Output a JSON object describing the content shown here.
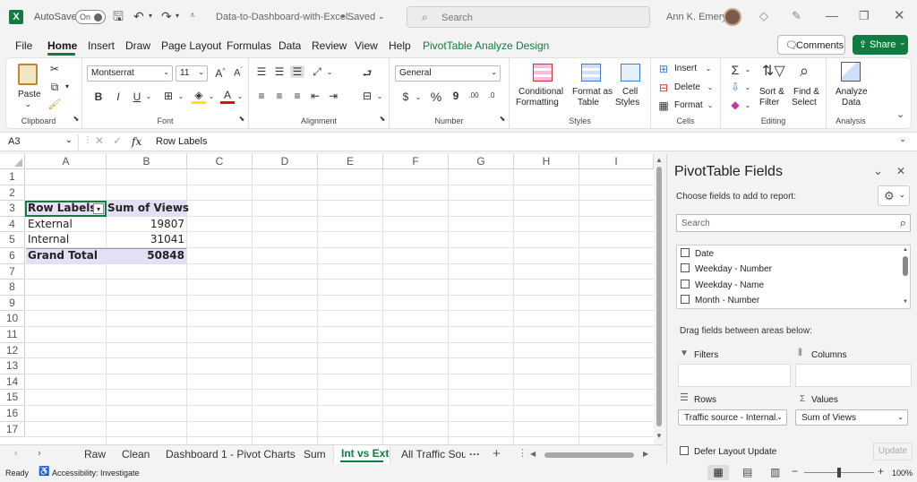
{
  "titlebar": {
    "autosave_label": "AutoSave",
    "autosave_state": "On",
    "filename": "Data-to-Dashboard-with-Excel...",
    "saved_status": "• Saved",
    "search_placeholder": "Search",
    "user_name": "Ann K. Emery"
  },
  "menu": {
    "items": [
      "File",
      "Home",
      "Insert",
      "Draw",
      "Page Layout",
      "Formulas",
      "Data",
      "Review",
      "View",
      "Help",
      "PivotTable Analyze",
      "Design"
    ],
    "comments_label": "Comments",
    "share_label": "Share"
  },
  "ribbon": {
    "paste_label": "Paste",
    "clipboard_label": "Clipboard",
    "font_name": "Montserrat",
    "font_size": "11",
    "font_label": "Font",
    "alignment_label": "Alignment",
    "number_format": "General",
    "number_label": "Number",
    "conditional_formatting": "Conditional",
    "conditional_formatting2": "Formatting",
    "format_as_table": "Format as",
    "format_as_table2": "Table",
    "cell_styles": "Cell",
    "cell_styles2": "Styles",
    "styles_label": "Styles",
    "insert_label": "Insert",
    "delete_label": "Delete",
    "format_label": "Format",
    "cells_label": "Cells",
    "sort_filter": "Sort &",
    "sort_filter2": "Filter",
    "find_select": "Find &",
    "find_select2": "Select",
    "editing_label": "Editing",
    "analyze_data": "Analyze",
    "analyze_data2": "Data",
    "analysis_label": "Analysis"
  },
  "formula_bar": {
    "name_box": "A3",
    "fx": "fx",
    "content": "Row Labels"
  },
  "grid": {
    "columns": [
      "A",
      "B",
      "C",
      "D",
      "E",
      "F",
      "G",
      "H",
      "I"
    ],
    "rows": [
      "1",
      "2",
      "3",
      "4",
      "5",
      "6",
      "7",
      "8",
      "9",
      "10",
      "11",
      "12",
      "13",
      "14",
      "15",
      "16",
      "17"
    ],
    "pivot": {
      "header_row_labels": "Row Labels",
      "header_sum": "Sum of Views",
      "rows": [
        {
          "label": "External",
          "value": "19807"
        },
        {
          "label": "Internal",
          "value": "31041"
        }
      ],
      "grand_total_label": "Grand Total",
      "grand_total_value": "50848"
    },
    "header_fill": "#e4dff5"
  },
  "sheet_tabs": {
    "tabs": [
      "Raw",
      "Clean",
      "Dashboard 1 - Pivot Charts",
      "Sum",
      "Int vs Ext",
      "All Traffic Sour"
    ],
    "active": "Int vs Ext",
    "ellipsis": "···"
  },
  "status": {
    "ready": "Ready",
    "accessibility": "Accessibility: Investigate",
    "zoom": "100%"
  },
  "pivot_pane": {
    "title": "PivotTable Fields",
    "subtitle": "Choose fields to add to report:",
    "search_placeholder": "Search",
    "fields": [
      "Date",
      "Weekday - Number",
      "Weekday - Name",
      "Month - Number"
    ],
    "drag_hint": "Drag fields between areas below:",
    "filters_label": "Filters",
    "columns_label": "Columns",
    "rows_label": "Rows",
    "values_label": "Values",
    "rows_value": "Traffic source - Internal...",
    "values_value": "Sum of Views",
    "defer_label": "Defer Layout Update",
    "update_label": "Update"
  },
  "colors": {
    "accent_green": "#107c41",
    "pivot_header": "#e4dff5"
  }
}
